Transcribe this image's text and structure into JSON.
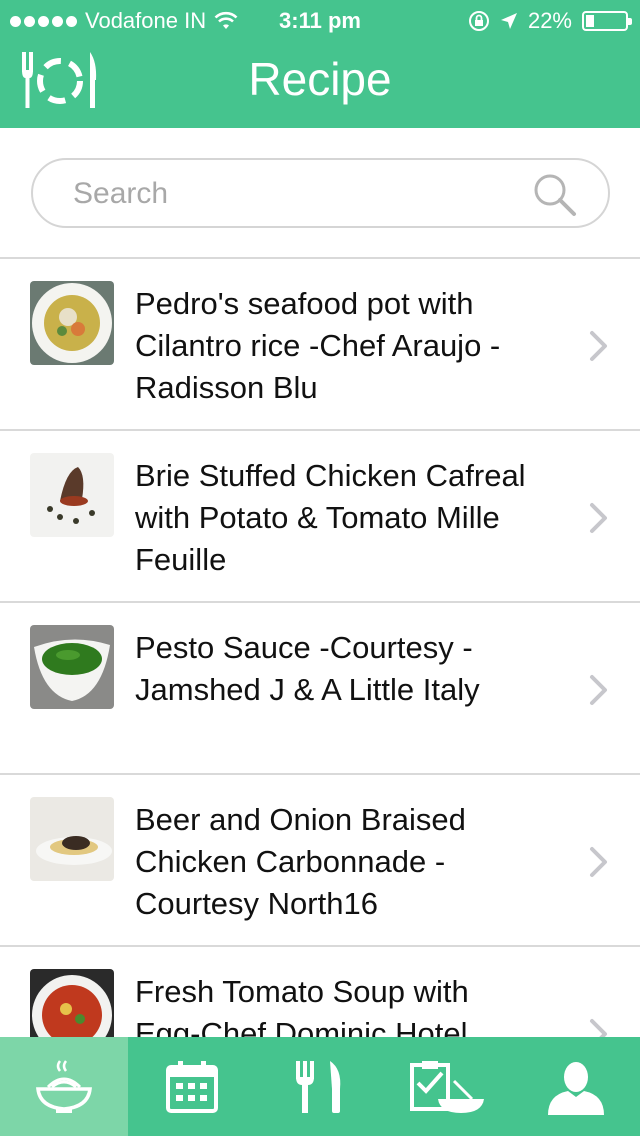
{
  "status_bar": {
    "carrier": "Vodafone IN",
    "time": "3:11 pm",
    "battery_percent": "22%",
    "battery_level": 0.22,
    "icons": [
      "signal-dots-icon",
      "wifi-icon",
      "rotation-lock-icon",
      "location-arrow-icon",
      "battery-icon"
    ]
  },
  "nav": {
    "title": "Recipe",
    "menu_icon": "plate-cutlery-icon"
  },
  "search": {
    "placeholder": "Search",
    "value": "",
    "icon": "search-icon"
  },
  "recipes": [
    {
      "title": "Pedro's seafood pot with Cilantro rice -Chef Araujo - Radisson Blu",
      "image": "seafood-pot-thumbnail"
    },
    {
      "title": "Brie Stuffed Chicken Cafreal with Potato & Tomato Mille Feuille",
      "image": "chicken-cafreal-thumbnail"
    },
    {
      "title": "Pesto Sauce -Courtesy - Jamshed J & A Little Italy",
      "image": "pesto-sauce-thumbnail"
    },
    {
      "title": "Beer and Onion Braised Chicken Carbonnade - Courtesy North16",
      "image": "chicken-carbonnade-thumbnail"
    },
    {
      "title": "Fresh Tomato Soup with Egg-Chef Dominic Hotel",
      "image": "tomato-soup-thumbnail"
    }
  ],
  "tabs": [
    {
      "icon": "noodle-bowl-icon",
      "active": true
    },
    {
      "icon": "calendar-icon",
      "active": false
    },
    {
      "icon": "fork-knife-icon",
      "active": false
    },
    {
      "icon": "checklist-icon",
      "active": false
    },
    {
      "icon": "user-icon",
      "active": false
    }
  ],
  "colors": {
    "primary": "#45c48e",
    "active_tab": "#7dd6a8",
    "divider": "#d9d9d9",
    "chevron": "#c7c7cc"
  }
}
